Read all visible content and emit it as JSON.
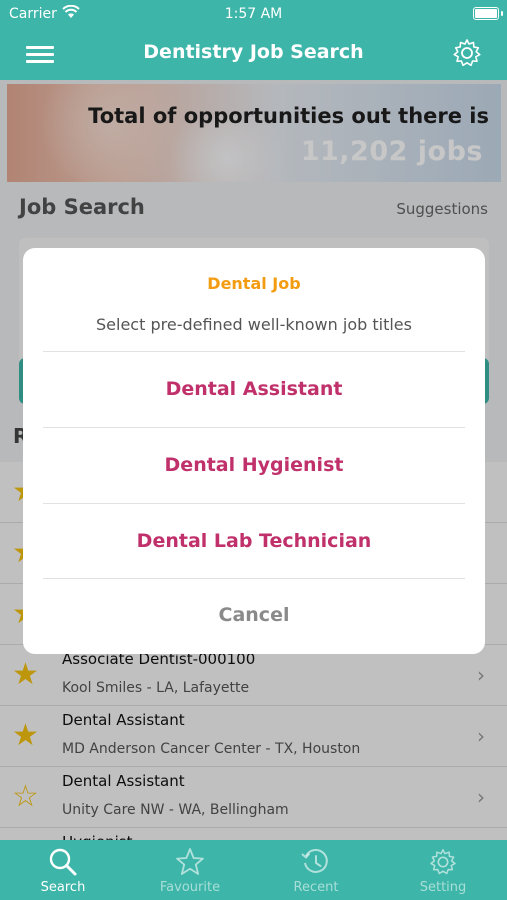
{
  "status_bar": {
    "carrier": "Carrier",
    "time": "1:57 AM"
  },
  "nav": {
    "title": "Dentistry Job Search",
    "menu_icon": "hamburger-menu-icon",
    "settings_icon": "gear-icon"
  },
  "banner": {
    "line1": "Total of opportunities out there is",
    "line2": "11,202 jobs"
  },
  "search_section": {
    "title": "Job Search",
    "suggestions_link": "Suggestions"
  },
  "recent_section": {
    "title_visible_fragment": "R"
  },
  "jobs": [
    {
      "title": "",
      "subtitle": "",
      "favourite": true
    },
    {
      "title": "",
      "subtitle": "",
      "favourite": true
    },
    {
      "title": "",
      "subtitle": "",
      "favourite": true
    },
    {
      "title": "Associate Dentist-000100",
      "subtitle": "Kool Smiles - LA, Lafayette",
      "favourite": true
    },
    {
      "title": "Dental Assistant",
      "subtitle": "MD Anderson Cancer Center - TX, Houston",
      "favourite": true
    },
    {
      "title": "Dental Assistant",
      "subtitle": "Unity Care NW - WA, Bellingham",
      "favourite": false
    },
    {
      "title": "Hygienist",
      "subtitle": "",
      "favourite": true
    }
  ],
  "action_sheet": {
    "title": "Dental Job",
    "message": "Select pre-defined well-known job titles",
    "options": [
      "Dental Assistant",
      "Dental Hygienist",
      "Dental Lab Technician"
    ],
    "cancel": "Cancel"
  },
  "tabbar": {
    "tabs": [
      {
        "label": "Search",
        "icon": "search-icon",
        "active": true
      },
      {
        "label": "Favourite",
        "icon": "star-icon",
        "active": false
      },
      {
        "label": "Recent",
        "icon": "history-icon",
        "active": false
      },
      {
        "label": "Setting",
        "icon": "gear-icon",
        "active": false
      }
    ]
  },
  "colors": {
    "primary": "#3db5a8",
    "accent_orange": "#f39c12",
    "option_magenta": "#c0306a",
    "star": "#f2c00f"
  }
}
